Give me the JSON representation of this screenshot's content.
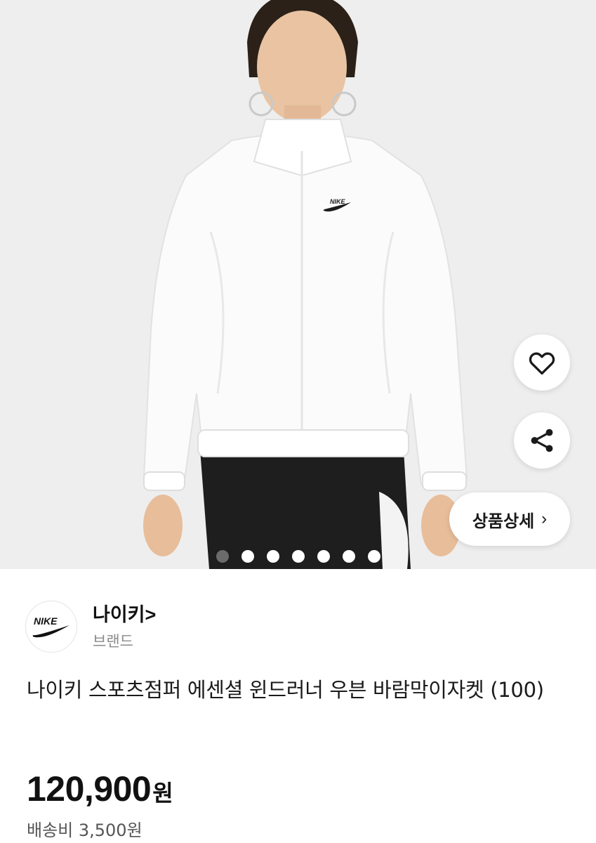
{
  "hero": {
    "image_icon": "product-photo",
    "total_images": 7,
    "active_index": 0
  },
  "actions": {
    "like_icon": "heart-outline-icon",
    "share_icon": "share-icon",
    "detail_label": "상품상세",
    "detail_chevron": "›"
  },
  "seller": {
    "brand_name": "나이키",
    "brand_arrow": ">",
    "brand_type": "브랜드",
    "logo_text": "NIKE"
  },
  "product": {
    "title": "나이키 스포츠점퍼 에센셜 윈드러너 우븐 바람막이자켓 (100)",
    "price_value": "120,900",
    "price_unit": "원",
    "shipping": "배송비 3,500원"
  }
}
